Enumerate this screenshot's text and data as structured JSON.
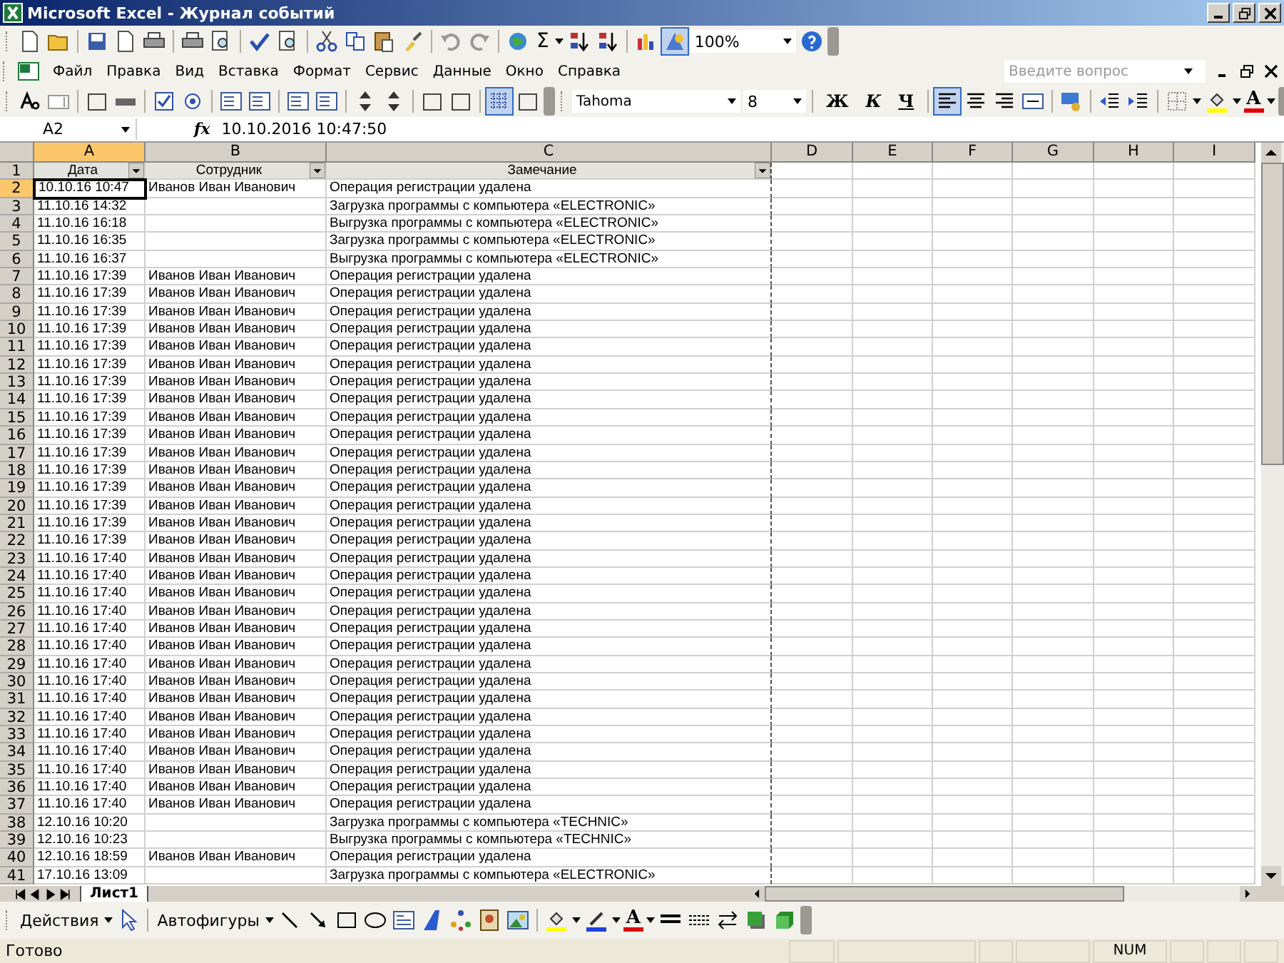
{
  "window": {
    "title": "Microsoft Excel - Журнал событий"
  },
  "standard_toolbar": {
    "sum": "Σ",
    "zoom": "100%"
  },
  "menu": [
    {
      "label": "Файл"
    },
    {
      "label": "Правка"
    },
    {
      "label": "Вид"
    },
    {
      "label": "Вставка"
    },
    {
      "label": "Формат"
    },
    {
      "label": "Сервис"
    },
    {
      "label": "Данные"
    },
    {
      "label": "Окно"
    },
    {
      "label": "Справка"
    }
  ],
  "help": {
    "placeholder": "Введите вопрос"
  },
  "formatting_toolbar": {
    "font": "Tahoma",
    "size": "8",
    "bold": "Ж",
    "italic": "К",
    "underline": "Ч",
    "font_color": "A"
  },
  "formula_bar": {
    "name_box": "A2",
    "function_label": "fx",
    "value": "10.10.2016  10:47:50"
  },
  "columns": [
    {
      "label": "A",
      "selected": true
    },
    {
      "label": "B",
      "selected": false
    },
    {
      "label": "C",
      "selected": false
    },
    {
      "label": "D",
      "selected": false
    },
    {
      "label": "E",
      "selected": false
    },
    {
      "label": "F",
      "selected": false
    },
    {
      "label": "G",
      "selected": false
    },
    {
      "label": "H",
      "selected": false
    },
    {
      "label": "I",
      "selected": false
    }
  ],
  "header_row": {
    "number": "1",
    "cells": [
      "Дата",
      "Сотрудник",
      "Замечание"
    ]
  },
  "rows": [
    {
      "number": "2",
      "selected": true,
      "cells": [
        "10.10.16 10:47",
        "Иванов Иван Иванович",
        "Операция регистрации удалена"
      ]
    },
    {
      "number": "3",
      "selected": false,
      "cells": [
        "11.10.16 14:32",
        "",
        "Загрузка программы с компьютера «ELECTRONIC»"
      ]
    },
    {
      "number": "4",
      "selected": false,
      "cells": [
        "11.10.16 16:18",
        "",
        "Выгрузка программы с компьютера «ELECTRONIC»"
      ]
    },
    {
      "number": "5",
      "selected": false,
      "cells": [
        "11.10.16 16:35",
        "",
        "Загрузка программы с компьютера «ELECTRONIC»"
      ]
    },
    {
      "number": "6",
      "selected": false,
      "cells": [
        "11.10.16 16:37",
        "",
        "Выгрузка программы с компьютера «ELECTRONIC»"
      ]
    },
    {
      "number": "7",
      "selected": false,
      "cells": [
        "11.10.16 17:39",
        "Иванов Иван Иванович",
        "Операция регистрации удалена"
      ]
    },
    {
      "number": "8",
      "selected": false,
      "cells": [
        "11.10.16 17:39",
        "Иванов Иван Иванович",
        "Операция регистрации удалена"
      ]
    },
    {
      "number": "9",
      "selected": false,
      "cells": [
        "11.10.16 17:39",
        "Иванов Иван Иванович",
        "Операция регистрации удалена"
      ]
    },
    {
      "number": "10",
      "selected": false,
      "cells": [
        "11.10.16 17:39",
        "Иванов Иван Иванович",
        "Операция регистрации удалена"
      ]
    },
    {
      "number": "11",
      "selected": false,
      "cells": [
        "11.10.16 17:39",
        "Иванов Иван Иванович",
        "Операция регистрации удалена"
      ]
    },
    {
      "number": "12",
      "selected": false,
      "cells": [
        "11.10.16 17:39",
        "Иванов Иван Иванович",
        "Операция регистрации удалена"
      ]
    },
    {
      "number": "13",
      "selected": false,
      "cells": [
        "11.10.16 17:39",
        "Иванов Иван Иванович",
        "Операция регистрации удалена"
      ]
    },
    {
      "number": "14",
      "selected": false,
      "cells": [
        "11.10.16 17:39",
        "Иванов Иван Иванович",
        "Операция регистрации удалена"
      ]
    },
    {
      "number": "15",
      "selected": false,
      "cells": [
        "11.10.16 17:39",
        "Иванов Иван Иванович",
        "Операция регистрации удалена"
      ]
    },
    {
      "number": "16",
      "selected": false,
      "cells": [
        "11.10.16 17:39",
        "Иванов Иван Иванович",
        "Операция регистрации удалена"
      ]
    },
    {
      "number": "17",
      "selected": false,
      "cells": [
        "11.10.16 17:39",
        "Иванов Иван Иванович",
        "Операция регистрации удалена"
      ]
    },
    {
      "number": "18",
      "selected": false,
      "cells": [
        "11.10.16 17:39",
        "Иванов Иван Иванович",
        "Операция регистрации удалена"
      ]
    },
    {
      "number": "19",
      "selected": false,
      "cells": [
        "11.10.16 17:39",
        "Иванов Иван Иванович",
        "Операция регистрации удалена"
      ]
    },
    {
      "number": "20",
      "selected": false,
      "cells": [
        "11.10.16 17:39",
        "Иванов Иван Иванович",
        "Операция регистрации удалена"
      ]
    },
    {
      "number": "21",
      "selected": false,
      "cells": [
        "11.10.16 17:39",
        "Иванов Иван Иванович",
        "Операция регистрации удалена"
      ]
    },
    {
      "number": "22",
      "selected": false,
      "cells": [
        "11.10.16 17:39",
        "Иванов Иван Иванович",
        "Операция регистрации удалена"
      ]
    },
    {
      "number": "23",
      "selected": false,
      "cells": [
        "11.10.16 17:40",
        "Иванов Иван Иванович",
        "Операция регистрации удалена"
      ]
    },
    {
      "number": "24",
      "selected": false,
      "cells": [
        "11.10.16 17:40",
        "Иванов Иван Иванович",
        "Операция регистрации удалена"
      ]
    },
    {
      "number": "25",
      "selected": false,
      "cells": [
        "11.10.16 17:40",
        "Иванов Иван Иванович",
        "Операция регистрации удалена"
      ]
    },
    {
      "number": "26",
      "selected": false,
      "cells": [
        "11.10.16 17:40",
        "Иванов Иван Иванович",
        "Операция регистрации удалена"
      ]
    },
    {
      "number": "27",
      "selected": false,
      "cells": [
        "11.10.16 17:40",
        "Иванов Иван Иванович",
        "Операция регистрации удалена"
      ]
    },
    {
      "number": "28",
      "selected": false,
      "cells": [
        "11.10.16 17:40",
        "Иванов Иван Иванович",
        "Операция регистрации удалена"
      ]
    },
    {
      "number": "29",
      "selected": false,
      "cells": [
        "11.10.16 17:40",
        "Иванов Иван Иванович",
        "Операция регистрации удалена"
      ]
    },
    {
      "number": "30",
      "selected": false,
      "cells": [
        "11.10.16 17:40",
        "Иванов Иван Иванович",
        "Операция регистрации удалена"
      ]
    },
    {
      "number": "31",
      "selected": false,
      "cells": [
        "11.10.16 17:40",
        "Иванов Иван Иванович",
        "Операция регистрации удалена"
      ]
    },
    {
      "number": "32",
      "selected": false,
      "cells": [
        "11.10.16 17:40",
        "Иванов Иван Иванович",
        "Операция регистрации удалена"
      ]
    },
    {
      "number": "33",
      "selected": false,
      "cells": [
        "11.10.16 17:40",
        "Иванов Иван Иванович",
        "Операция регистрации удалена"
      ]
    },
    {
      "number": "34",
      "selected": false,
      "cells": [
        "11.10.16 17:40",
        "Иванов Иван Иванович",
        "Операция регистрации удалена"
      ]
    },
    {
      "number": "35",
      "selected": false,
      "cells": [
        "11.10.16 17:40",
        "Иванов Иван Иванович",
        "Операция регистрации удалена"
      ]
    },
    {
      "number": "36",
      "selected": false,
      "cells": [
        "11.10.16 17:40",
        "Иванов Иван Иванович",
        "Операция регистрации удалена"
      ]
    },
    {
      "number": "37",
      "selected": false,
      "cells": [
        "11.10.16 17:40",
        "Иванов Иван Иванович",
        "Операция регистрации удалена"
      ]
    },
    {
      "number": "38",
      "selected": false,
      "cells": [
        "12.10.16 10:20",
        "",
        "Загрузка программы с компьютера «TECHNIC»"
      ]
    },
    {
      "number": "39",
      "selected": false,
      "cells": [
        "12.10.16 10:23",
        "",
        "Выгрузка программы с компьютера «TECHNIC»"
      ]
    },
    {
      "number": "40",
      "selected": false,
      "cells": [
        "12.10.16 18:59",
        "Иванов Иван Иванович",
        "Операция регистрации удалена"
      ]
    },
    {
      "number": "41",
      "selected": false,
      "cells": [
        "17.10.16 13:09",
        "",
        "Загрузка программы с компьютера «ELECTRONIC»"
      ]
    }
  ],
  "sheet_tabs": [
    {
      "label": "Лист1",
      "selected": true
    }
  ],
  "drawing_toolbar": {
    "actions": "Действия",
    "autoshapes": "Автофигуры",
    "font_color": "A"
  },
  "status_bar": {
    "status": "Готово",
    "num": "NUM"
  }
}
